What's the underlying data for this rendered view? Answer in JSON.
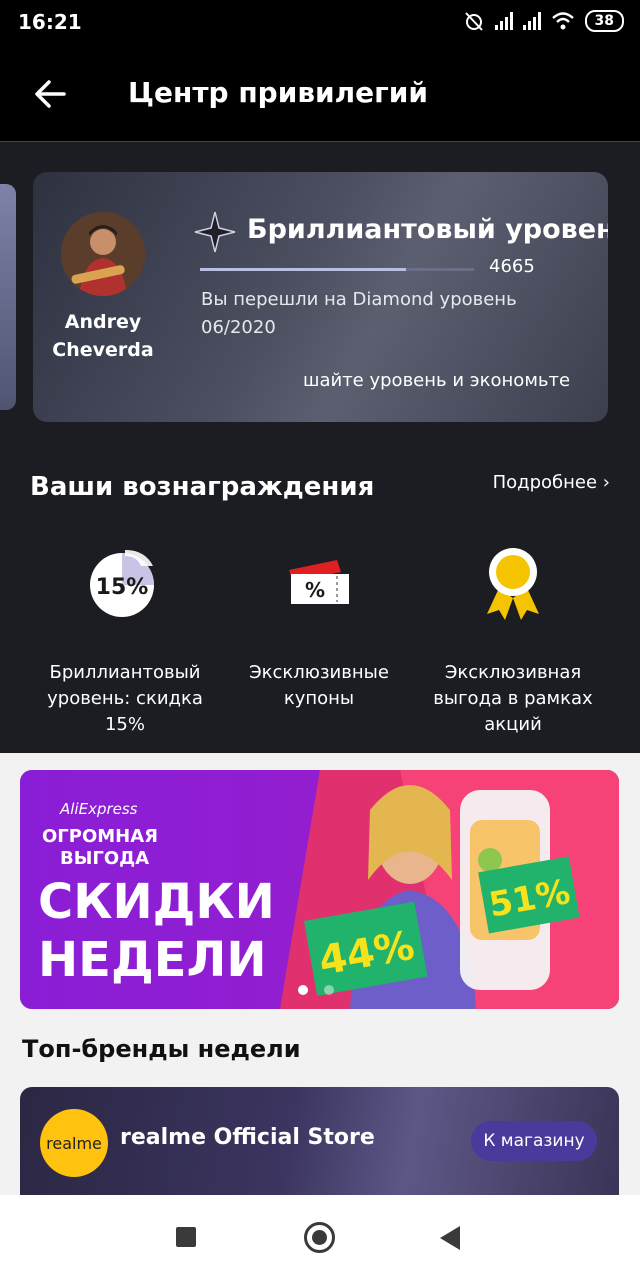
{
  "status_bar": {
    "time": "16:21",
    "battery": "38"
  },
  "header": {
    "title": "Центр привилегий"
  },
  "profile": {
    "name": "Andrey Cheverda",
    "level_title": "Бриллиантовый уровень",
    "points": "4665",
    "level_progress": 0.75,
    "level_description": "Вы перешли на Diamond уровень 06/2020",
    "promo_text": "шайте уровень и экономьте"
  },
  "rewards": {
    "title": "Ваши вознаграждения",
    "more_link": "Подробнее ›",
    "items": [
      {
        "icon": "discount-15-icon",
        "badge": "15%",
        "label": "Бриллиантовый уровень: скидка 15%"
      },
      {
        "icon": "coupon-icon",
        "badge": "%",
        "label": "Эксклюзивные купоны"
      },
      {
        "icon": "medal-icon",
        "label": "Эксклюзивная выгода в рамках акций"
      }
    ]
  },
  "banner": {
    "brand": "AliExpress",
    "tagline_1": "ОГРОМНАЯ",
    "tagline_2": "ВЫГОДА",
    "headline_1": "СКИДКИ",
    "headline_2": "НЕДЕЛИ",
    "discount_1": "44%",
    "discount_2": "51%",
    "slide_index": 1,
    "slide_count": 2
  },
  "top_brands": {
    "title": "Топ-бренды недели",
    "logo_text": "realme",
    "store_name": "realme Official Store",
    "button": "К магазину"
  },
  "colors": {
    "dark_bg": "#1b1d23",
    "banner_purple": "#8a1ed6",
    "accent_yellow": "#ffc20e"
  }
}
